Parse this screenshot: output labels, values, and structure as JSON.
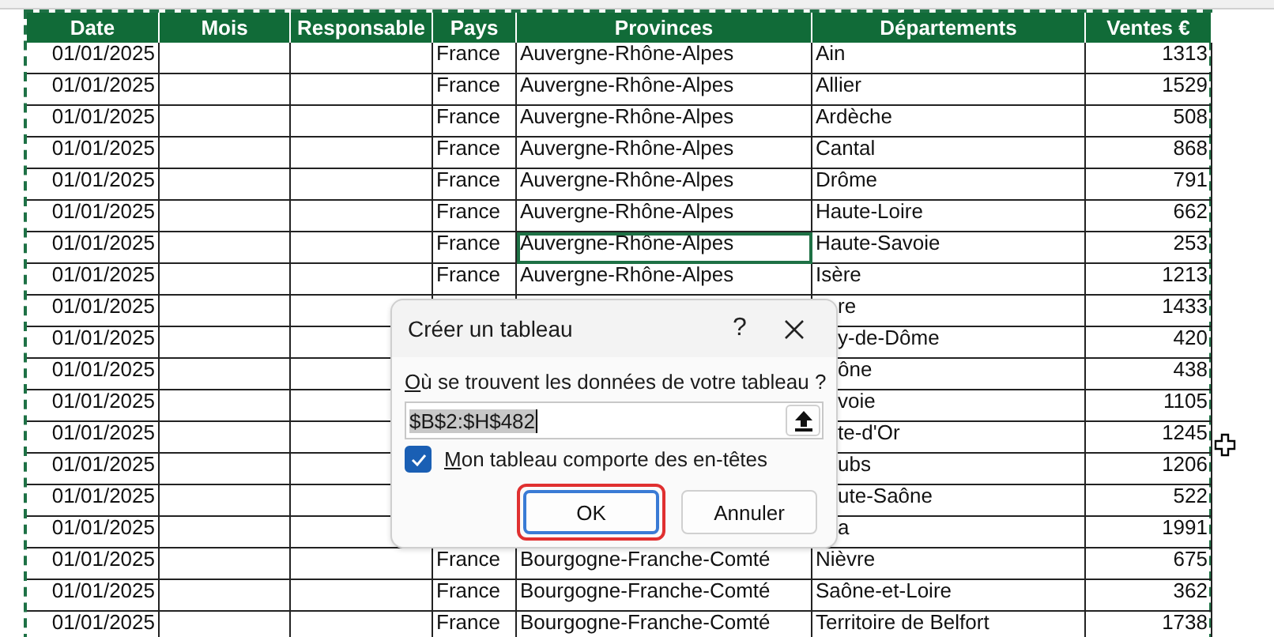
{
  "columns": [
    "Date",
    "Mois",
    "Responsable",
    "Pays",
    "Provinces",
    "Départements",
    "Ventes €"
  ],
  "rows": [
    {
      "date": "01/01/2025",
      "country": "France",
      "province": "Auvergne-Rhône-Alpes",
      "department": "Ain",
      "sales": "1313",
      "selected": false,
      "covered": false
    },
    {
      "date": "01/01/2025",
      "country": "France",
      "province": "Auvergne-Rhône-Alpes",
      "department": "Allier",
      "sales": "1529",
      "selected": false,
      "covered": false
    },
    {
      "date": "01/01/2025",
      "country": "France",
      "province": "Auvergne-Rhône-Alpes",
      "department": "Ardèche",
      "sales": "508",
      "selected": false,
      "covered": false
    },
    {
      "date": "01/01/2025",
      "country": "France",
      "province": "Auvergne-Rhône-Alpes",
      "department": "Cantal",
      "sales": "868",
      "selected": false,
      "covered": false
    },
    {
      "date": "01/01/2025",
      "country": "France",
      "province": "Auvergne-Rhône-Alpes",
      "department": "Drôme",
      "sales": "791",
      "selected": false,
      "covered": false
    },
    {
      "date": "01/01/2025",
      "country": "France",
      "province": "Auvergne-Rhône-Alpes",
      "department": "Haute-Loire",
      "sales": "662",
      "selected": false,
      "covered": false
    },
    {
      "date": "01/01/2025",
      "country": "France",
      "province": "Auvergne-Rhône-Alpes",
      "department": "Haute-Savoie",
      "sales": "253",
      "selected": true,
      "covered": false
    },
    {
      "date": "01/01/2025",
      "country": "France",
      "province": "Auvergne-Rhône-Alpes",
      "department": "Isère",
      "sales": "1213",
      "selected": false,
      "covered": false
    },
    {
      "date": "01/01/2025",
      "department": "re",
      "sales": "1433",
      "covered": true
    },
    {
      "date": "01/01/2025",
      "department": "y-de-Dôme",
      "sales": "420",
      "covered": true
    },
    {
      "date": "01/01/2025",
      "department": "ône",
      "sales": "438",
      "covered": true
    },
    {
      "date": "01/01/2025",
      "department": "voie",
      "sales": "1105",
      "covered": true
    },
    {
      "date": "01/01/2025",
      "department": "te-d'Or",
      "sales": "1245",
      "covered": true
    },
    {
      "date": "01/01/2025",
      "department": "ubs",
      "sales": "1206",
      "covered": true
    },
    {
      "date": "01/01/2025",
      "department": "ute-Saône",
      "sales": "522",
      "covered": true
    },
    {
      "date": "01/01/2025",
      "department": "a",
      "sales": "1991",
      "covered": true
    },
    {
      "date": "01/01/2025",
      "country": "France",
      "province": "Bourgogne-Franche-Comté",
      "department": "Nièvre",
      "sales": "675",
      "selected": false,
      "covered": false
    },
    {
      "date": "01/01/2025",
      "country": "France",
      "province": "Bourgogne-Franche-Comté",
      "department": "Saône-et-Loire",
      "sales": "362",
      "selected": false,
      "covered": false
    },
    {
      "date": "01/01/2025",
      "country": "France",
      "province": "Bourgogne-Franche-Comté",
      "department": "Territoire de Belfort",
      "sales": "1738",
      "selected": false,
      "covered": false
    }
  ],
  "dialog": {
    "title": "Créer un tableau",
    "help": "?",
    "prompt": {
      "access_key": "O",
      "text": "ù se trouvent les données de votre tableau ?"
    },
    "range": {
      "value": "$B$2:$H$482",
      "selected": true
    },
    "headers_checkbox": {
      "access_key": "M",
      "label": "on tableau comporte des en-têtes",
      "checked": true
    },
    "buttons": [
      {
        "label": "OK",
        "focused": true,
        "highlighted": true
      },
      {
        "label": "Annuler",
        "focused": false,
        "highlighted": false
      }
    ]
  }
}
